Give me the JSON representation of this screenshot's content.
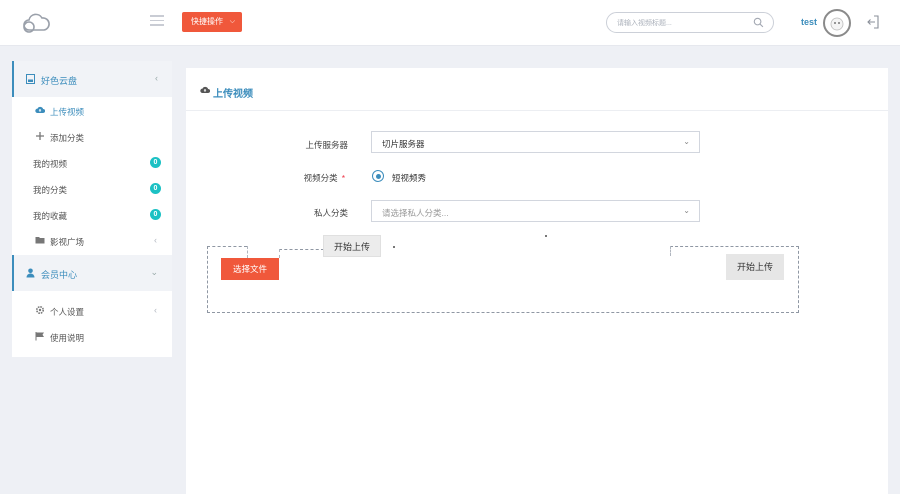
{
  "header": {
    "quick_action_label": "快捷操作",
    "search_placeholder": "请输入视频标题...",
    "username": "test"
  },
  "sidebar": {
    "group1": {
      "label": "好色云盘"
    },
    "items1": [
      {
        "label": "上传视频"
      },
      {
        "label": "添加分类"
      },
      {
        "label": "我的视频",
        "badge": "0"
      },
      {
        "label": "我的分类",
        "badge": "0"
      },
      {
        "label": "我的收藏",
        "badge": "0"
      },
      {
        "label": "影视广场"
      }
    ],
    "group2": {
      "label": "会员中心"
    },
    "items2": [
      {
        "label": "个人设置"
      },
      {
        "label": "使用说明"
      }
    ]
  },
  "main": {
    "title": "上传视频",
    "form": {
      "server_label": "上传服务器",
      "server_value": "切片服务器",
      "category_label": "视频分类",
      "category_required": "*",
      "category_option": "短视频秀",
      "private_label": "私人分类",
      "private_placeholder": "请选择私人分类..."
    },
    "upload": {
      "choose_label": "选择文件",
      "start_label": "开始上传",
      "start_label_right": "开始上传"
    }
  },
  "colors": {
    "accent": "#3c8dbc",
    "orange": "#f0583b",
    "badge": "#1cc1c4"
  },
  "icons": [
    "cloud-logo-icon",
    "menu-icon",
    "search-icon",
    "avatar-icon",
    "logout-icon",
    "disk-icon",
    "upload-cloud-icon",
    "plus-icon",
    "folder-icon",
    "user-icon",
    "gear-icon",
    "flag-icon"
  ]
}
